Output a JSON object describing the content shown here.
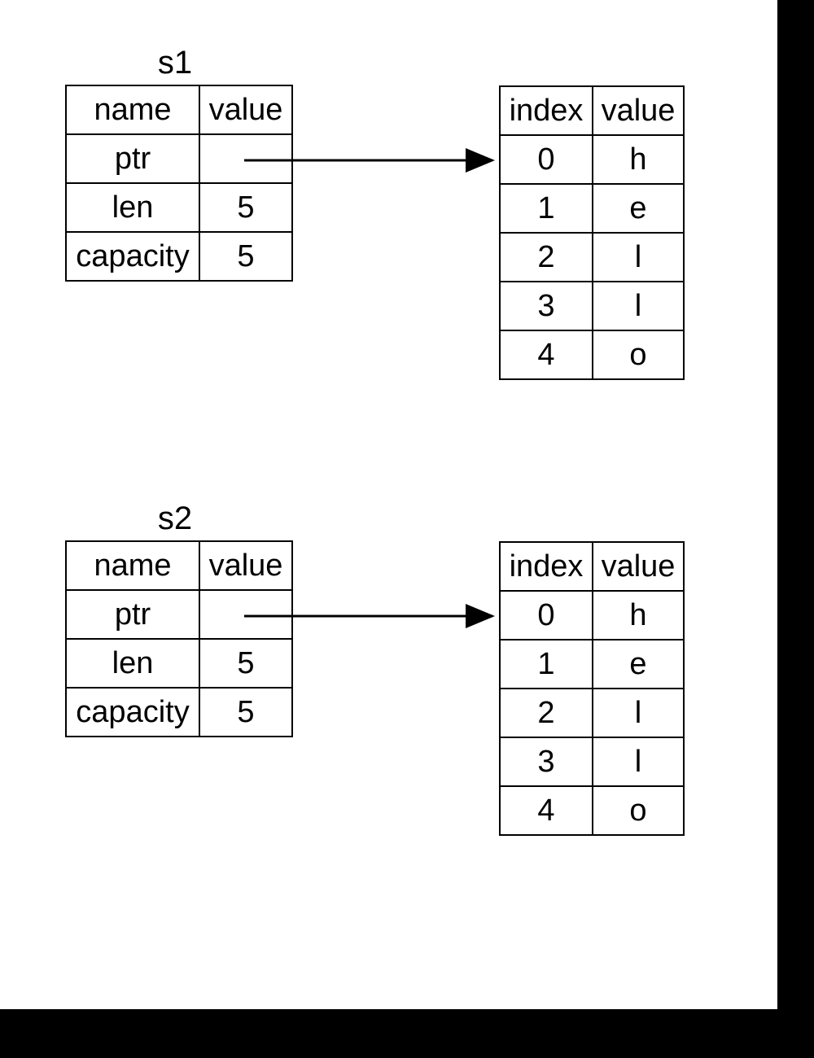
{
  "s1": {
    "title": "s1",
    "struct": {
      "headers": [
        "name",
        "value"
      ],
      "rows": [
        {
          "name": "ptr",
          "value": ""
        },
        {
          "name": "len",
          "value": "5"
        },
        {
          "name": "capacity",
          "value": "5"
        }
      ]
    },
    "heap": {
      "headers": [
        "index",
        "value"
      ],
      "rows": [
        {
          "index": "0",
          "value": "h"
        },
        {
          "index": "1",
          "value": "e"
        },
        {
          "index": "2",
          "value": "l"
        },
        {
          "index": "3",
          "value": "l"
        },
        {
          "index": "4",
          "value": "o"
        }
      ]
    }
  },
  "s2": {
    "title": "s2",
    "struct": {
      "headers": [
        "name",
        "value"
      ],
      "rows": [
        {
          "name": "ptr",
          "value": ""
        },
        {
          "name": "len",
          "value": "5"
        },
        {
          "name": "capacity",
          "value": "5"
        }
      ]
    },
    "heap": {
      "headers": [
        "index",
        "value"
      ],
      "rows": [
        {
          "index": "0",
          "value": "h"
        },
        {
          "index": "1",
          "value": "e"
        },
        {
          "index": "2",
          "value": "l"
        },
        {
          "index": "3",
          "value": "l"
        },
        {
          "index": "4",
          "value": "o"
        }
      ]
    }
  }
}
